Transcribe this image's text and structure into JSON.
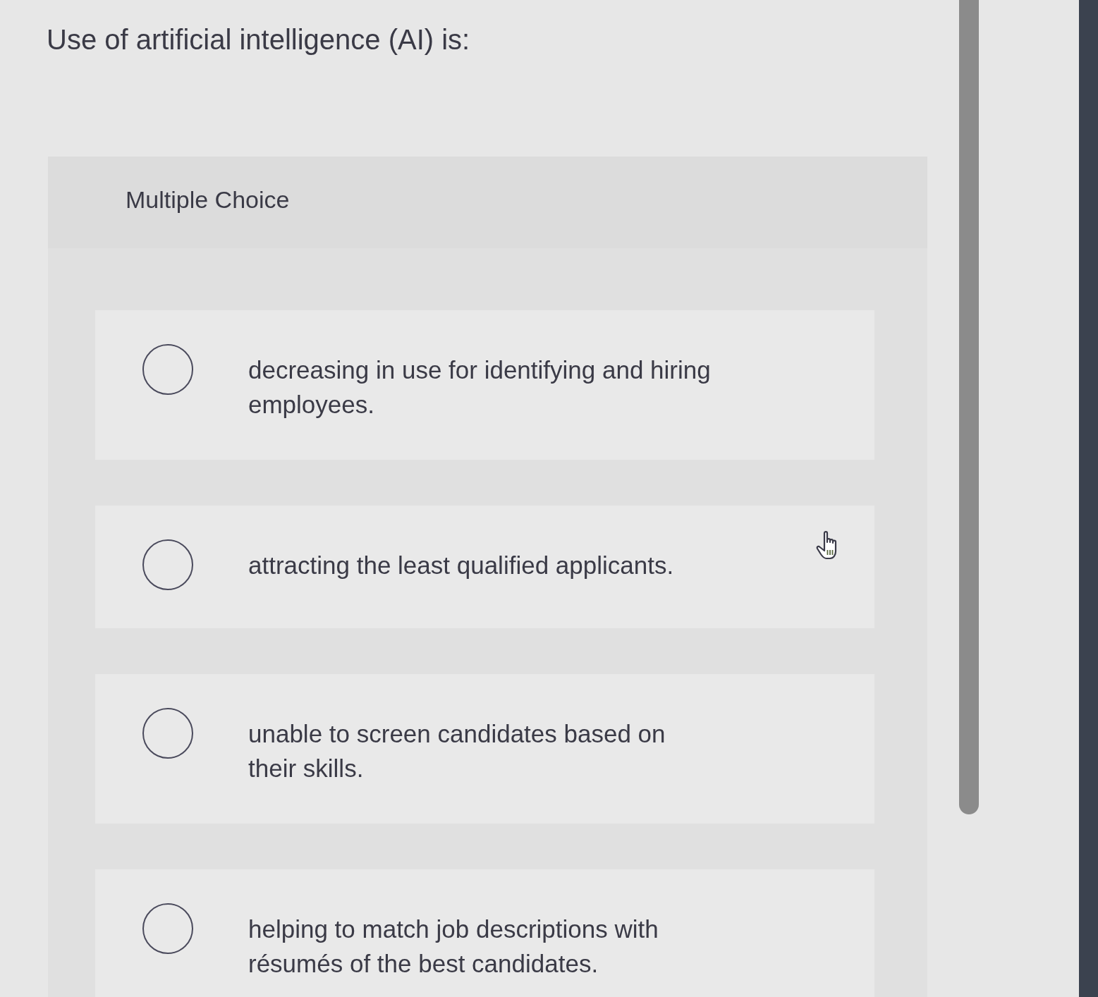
{
  "question": {
    "prompt": "Use of artificial intelligence (AI) is:"
  },
  "answer_panel": {
    "question_type": "Multiple Choice",
    "options": [
      {
        "text": "decreasing in use for identifying and hiring employees.",
        "selected": false
      },
      {
        "text": "attracting the least qualified applicants.",
        "selected": false
      },
      {
        "text": "unable to screen candidates based on their skills.",
        "selected": false
      },
      {
        "text": "helping to match job descriptions with résumés of the best candidates.",
        "selected": false
      }
    ]
  }
}
